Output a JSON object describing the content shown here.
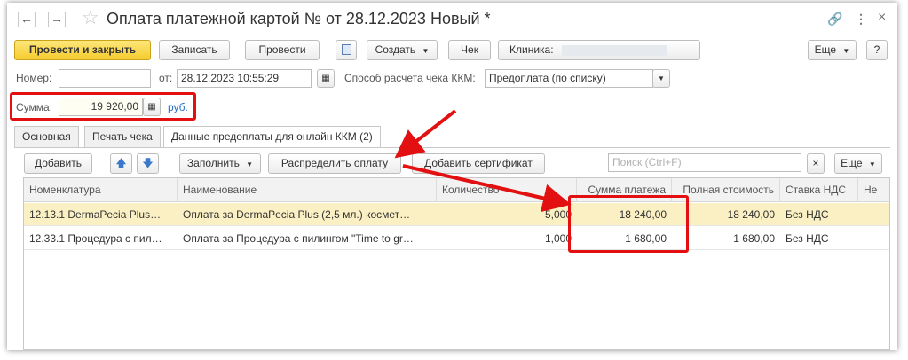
{
  "titlebar": {
    "back": "←",
    "forward": "→",
    "title": "Оплата платежной картой №  от 28.12.2023 Новый *",
    "link_icon": "🔗",
    "more_icon": "⋮",
    "close_icon": "×"
  },
  "toolbar": {
    "post_close": "Провести и закрыть",
    "save": "Записать",
    "post": "Провести",
    "create": "Создать",
    "check": "Чек",
    "clinic_label": "Клиника:",
    "more": "Еще",
    "help": "?"
  },
  "form": {
    "number_label": "Номер:",
    "number_value": "",
    "from_label": "от:",
    "date_value": "28.12.2023 10:55:29",
    "method_label": "Способ расчета чека ККМ:",
    "method_value": "Предоплата (по списку)",
    "sum_label": "Сумма:",
    "sum_value": "19 920,00",
    "currency": "руб."
  },
  "tabs": [
    {
      "label": "Основная"
    },
    {
      "label": "Печать чека"
    },
    {
      "label": "Данные предоплаты для онлайн ККМ (2)"
    }
  ],
  "table_toolbar": {
    "add": "Добавить",
    "up": "🡅",
    "down": "🡇",
    "fill": "Заполнить",
    "distribute": "Распределить оплату",
    "add_certificate": "Добавить сертификат",
    "search_placeholder": "Поиск (Ctrl+F)",
    "clear": "×",
    "more": "Еще"
  },
  "table": {
    "columns": [
      "Номенклатура",
      "Наименование",
      "Количество",
      "Сумма платежа",
      "Полная стоимость",
      "Ставка НДС",
      "Не"
    ],
    "rows": [
      {
        "nomenclature": "12.13.1 DermaPecia Plus…",
        "name": "Оплата за DermaPecia Plus (2,5 мл.) космет…",
        "qty": "5,000",
        "payment": "18 240,00",
        "full": "18 240,00",
        "vat": "Без НДС"
      },
      {
        "nomenclature": "12.33.1 Процедура с пил…",
        "name": "Оплата за Процедура с пилингом \"Time to gr…",
        "qty": "1,000",
        "payment": "1 680,00",
        "full": "1 680,00",
        "vat": "Без НДС"
      }
    ]
  },
  "colors": {
    "highlight_red": "#e21010",
    "primary_button": "#f5cc2e",
    "selected_row": "#fbf0c4",
    "link_blue": "#2a6fc1"
  }
}
